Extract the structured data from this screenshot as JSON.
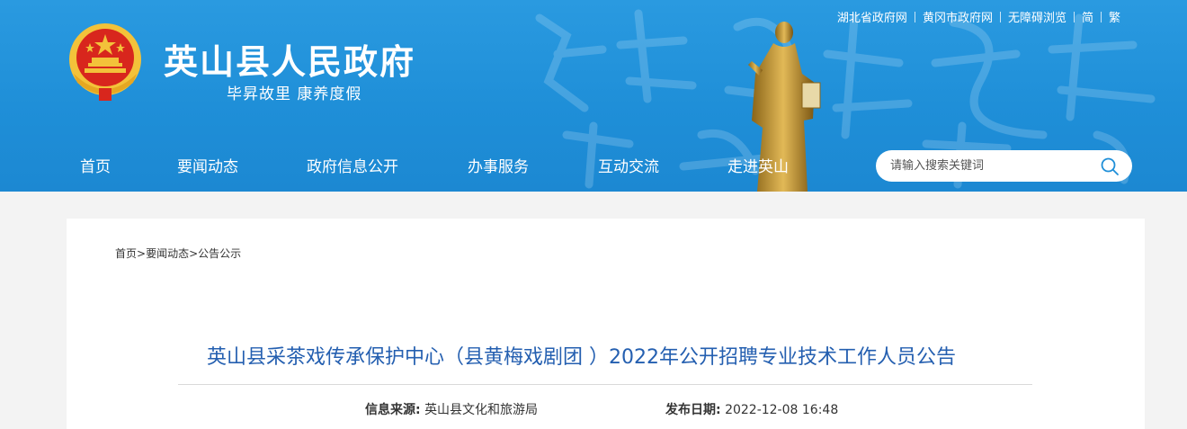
{
  "header": {
    "site_title": "英山县人民政府",
    "slogan": "毕昇故里 康养度假",
    "top_links": [
      "湖北省政府网",
      "黄冈市政府网",
      "无障碍浏览",
      "简",
      "繁"
    ]
  },
  "nav": {
    "items": [
      "首页",
      "要闻动态",
      "政府信息公开",
      "办事服务",
      "互动交流",
      "走进英山"
    ]
  },
  "search": {
    "placeholder": "请输入搜索关键词",
    "icon": "search-icon"
  },
  "breadcrumb": {
    "items": [
      "首页",
      "要闻动态",
      "公告公示"
    ],
    "separator": ">"
  },
  "article": {
    "title": "英山县采茶戏传承保护中心（县黄梅戏剧团 ）2022年公开招聘专业技术工作人员公告",
    "source_label": "信息来源:",
    "source_value": "英山县文化和旅游局",
    "date_label": "发布日期:",
    "date_value": "2022-12-08 16:48"
  },
  "colors": {
    "header_blue": "#1f8fd8",
    "title_blue": "#245fb0",
    "emblem_red": "#d8261d",
    "emblem_gold": "#f3c23a"
  }
}
